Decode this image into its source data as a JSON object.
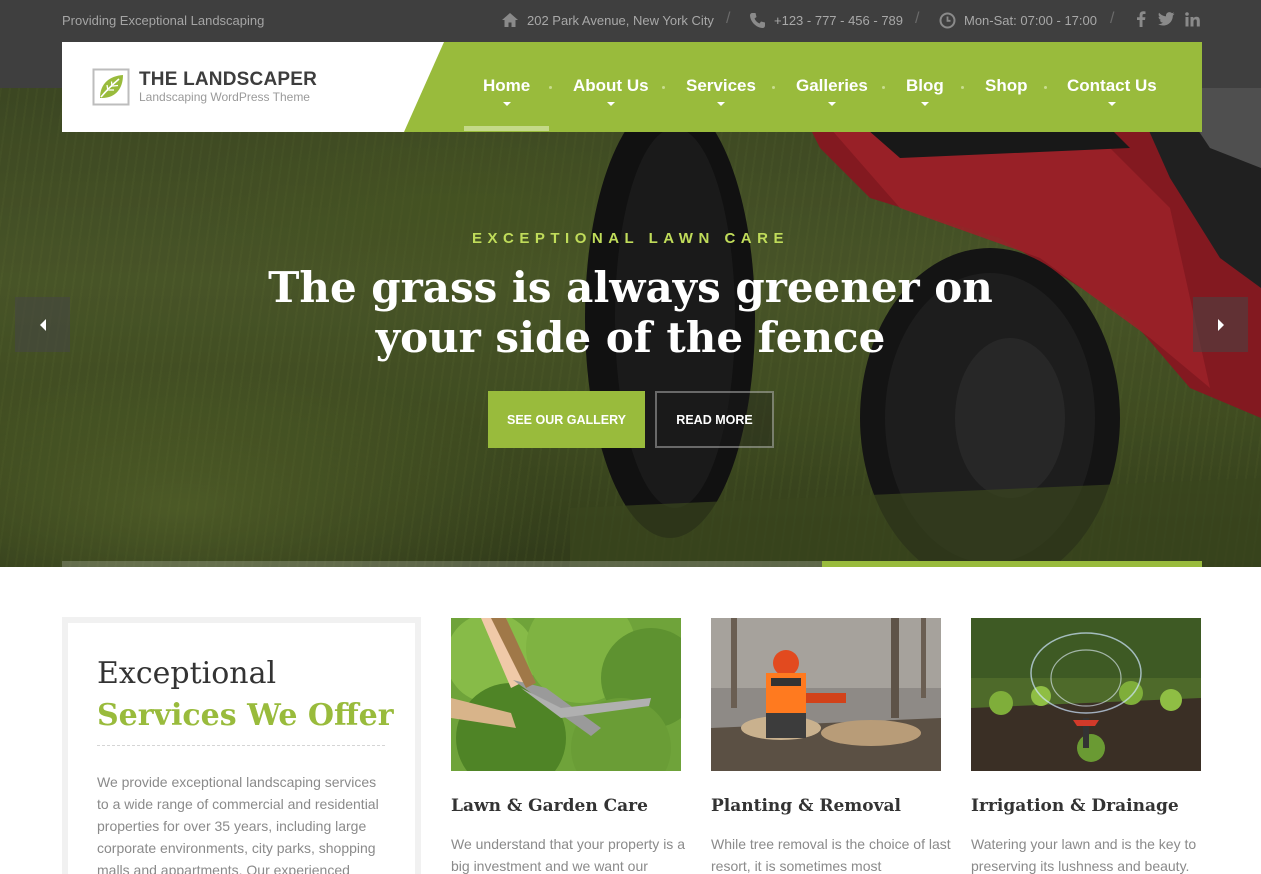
{
  "topbar": {
    "tagline": "Providing Exceptional Landscaping",
    "address": "202 Park Avenue, New York City",
    "phone": "+123 - 777 - 456 - 789",
    "hours": "Mon-Sat: 07:00 - 17:00",
    "separator": "/",
    "social": [
      "facebook-icon",
      "twitter-icon",
      "linkedin-icon"
    ]
  },
  "brand": {
    "title": "THE LANDSCAPER",
    "subtitle": "Landscaping WordPress Theme"
  },
  "nav": {
    "items": [
      {
        "label": "Home",
        "active": true
      },
      {
        "label": "About Us"
      },
      {
        "label": "Services"
      },
      {
        "label": "Galleries"
      },
      {
        "label": "Blog"
      },
      {
        "label": "Shop"
      },
      {
        "label": "Contact Us"
      }
    ]
  },
  "hero": {
    "kicker": "EXCEPTIONAL LAWN CARE",
    "headline_line1": "The grass is always greener on",
    "headline_line2": "your side of the fence",
    "primary_button": "SEE OUR GALLERY",
    "secondary_button": "READ MORE",
    "slide_progress": 0.333
  },
  "intro": {
    "heading_line1": "Exceptional",
    "heading_line2": "Services We Offer",
    "text": "We provide exceptional landscaping services to a wide range of commercial and residential properties for over 35 years, including large corporate environments, city parks, shopping malls and appartments. Our experienced"
  },
  "services": [
    {
      "title": "Lawn & Garden Care",
      "text": "We understand that your property is a big investment and we want our"
    },
    {
      "title": "Planting & Removal",
      "text": "While tree removal is the choice of last resort, it is sometimes most"
    },
    {
      "title": "Irrigation & Drainage",
      "text": "Watering your lawn and is the key to preserving its lushness and beauty."
    }
  ],
  "colors": {
    "accent": "#99bb3c",
    "topbar": "#3f3f3f",
    "kicker": "#c0dc5a"
  }
}
